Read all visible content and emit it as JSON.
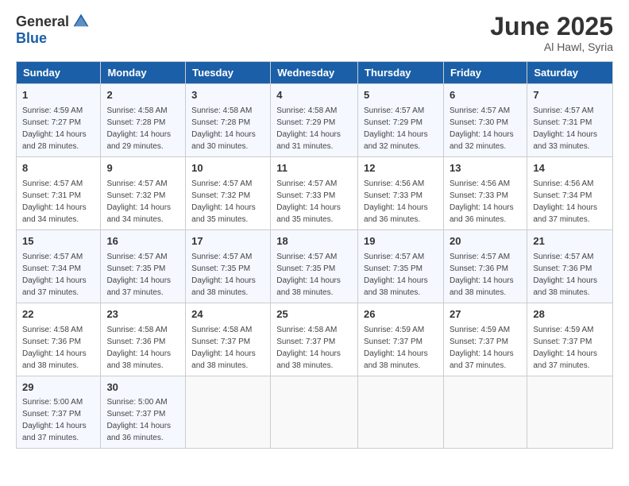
{
  "logo": {
    "general": "General",
    "blue": "Blue"
  },
  "title": "June 2025",
  "location": "Al Hawl, Syria",
  "header_days": [
    "Sunday",
    "Monday",
    "Tuesday",
    "Wednesday",
    "Thursday",
    "Friday",
    "Saturday"
  ],
  "weeks": [
    [
      {
        "day": "1",
        "sunrise": "Sunrise: 4:59 AM",
        "sunset": "Sunset: 7:27 PM",
        "daylight": "Daylight: 14 hours and 28 minutes."
      },
      {
        "day": "2",
        "sunrise": "Sunrise: 4:58 AM",
        "sunset": "Sunset: 7:28 PM",
        "daylight": "Daylight: 14 hours and 29 minutes."
      },
      {
        "day": "3",
        "sunrise": "Sunrise: 4:58 AM",
        "sunset": "Sunset: 7:28 PM",
        "daylight": "Daylight: 14 hours and 30 minutes."
      },
      {
        "day": "4",
        "sunrise": "Sunrise: 4:58 AM",
        "sunset": "Sunset: 7:29 PM",
        "daylight": "Daylight: 14 hours and 31 minutes."
      },
      {
        "day": "5",
        "sunrise": "Sunrise: 4:57 AM",
        "sunset": "Sunset: 7:29 PM",
        "daylight": "Daylight: 14 hours and 32 minutes."
      },
      {
        "day": "6",
        "sunrise": "Sunrise: 4:57 AM",
        "sunset": "Sunset: 7:30 PM",
        "daylight": "Daylight: 14 hours and 32 minutes."
      },
      {
        "day": "7",
        "sunrise": "Sunrise: 4:57 AM",
        "sunset": "Sunset: 7:31 PM",
        "daylight": "Daylight: 14 hours and 33 minutes."
      }
    ],
    [
      {
        "day": "8",
        "sunrise": "Sunrise: 4:57 AM",
        "sunset": "Sunset: 7:31 PM",
        "daylight": "Daylight: 14 hours and 34 minutes."
      },
      {
        "day": "9",
        "sunrise": "Sunrise: 4:57 AM",
        "sunset": "Sunset: 7:32 PM",
        "daylight": "Daylight: 14 hours and 34 minutes."
      },
      {
        "day": "10",
        "sunrise": "Sunrise: 4:57 AM",
        "sunset": "Sunset: 7:32 PM",
        "daylight": "Daylight: 14 hours and 35 minutes."
      },
      {
        "day": "11",
        "sunrise": "Sunrise: 4:57 AM",
        "sunset": "Sunset: 7:33 PM",
        "daylight": "Daylight: 14 hours and 35 minutes."
      },
      {
        "day": "12",
        "sunrise": "Sunrise: 4:56 AM",
        "sunset": "Sunset: 7:33 PM",
        "daylight": "Daylight: 14 hours and 36 minutes."
      },
      {
        "day": "13",
        "sunrise": "Sunrise: 4:56 AM",
        "sunset": "Sunset: 7:33 PM",
        "daylight": "Daylight: 14 hours and 36 minutes."
      },
      {
        "day": "14",
        "sunrise": "Sunrise: 4:56 AM",
        "sunset": "Sunset: 7:34 PM",
        "daylight": "Daylight: 14 hours and 37 minutes."
      }
    ],
    [
      {
        "day": "15",
        "sunrise": "Sunrise: 4:57 AM",
        "sunset": "Sunset: 7:34 PM",
        "daylight": "Daylight: 14 hours and 37 minutes."
      },
      {
        "day": "16",
        "sunrise": "Sunrise: 4:57 AM",
        "sunset": "Sunset: 7:35 PM",
        "daylight": "Daylight: 14 hours and 37 minutes."
      },
      {
        "day": "17",
        "sunrise": "Sunrise: 4:57 AM",
        "sunset": "Sunset: 7:35 PM",
        "daylight": "Daylight: 14 hours and 38 minutes."
      },
      {
        "day": "18",
        "sunrise": "Sunrise: 4:57 AM",
        "sunset": "Sunset: 7:35 PM",
        "daylight": "Daylight: 14 hours and 38 minutes."
      },
      {
        "day": "19",
        "sunrise": "Sunrise: 4:57 AM",
        "sunset": "Sunset: 7:35 PM",
        "daylight": "Daylight: 14 hours and 38 minutes."
      },
      {
        "day": "20",
        "sunrise": "Sunrise: 4:57 AM",
        "sunset": "Sunset: 7:36 PM",
        "daylight": "Daylight: 14 hours and 38 minutes."
      },
      {
        "day": "21",
        "sunrise": "Sunrise: 4:57 AM",
        "sunset": "Sunset: 7:36 PM",
        "daylight": "Daylight: 14 hours and 38 minutes."
      }
    ],
    [
      {
        "day": "22",
        "sunrise": "Sunrise: 4:58 AM",
        "sunset": "Sunset: 7:36 PM",
        "daylight": "Daylight: 14 hours and 38 minutes."
      },
      {
        "day": "23",
        "sunrise": "Sunrise: 4:58 AM",
        "sunset": "Sunset: 7:36 PM",
        "daylight": "Daylight: 14 hours and 38 minutes."
      },
      {
        "day": "24",
        "sunrise": "Sunrise: 4:58 AM",
        "sunset": "Sunset: 7:37 PM",
        "daylight": "Daylight: 14 hours and 38 minutes."
      },
      {
        "day": "25",
        "sunrise": "Sunrise: 4:58 AM",
        "sunset": "Sunset: 7:37 PM",
        "daylight": "Daylight: 14 hours and 38 minutes."
      },
      {
        "day": "26",
        "sunrise": "Sunrise: 4:59 AM",
        "sunset": "Sunset: 7:37 PM",
        "daylight": "Daylight: 14 hours and 38 minutes."
      },
      {
        "day": "27",
        "sunrise": "Sunrise: 4:59 AM",
        "sunset": "Sunset: 7:37 PM",
        "daylight": "Daylight: 14 hours and 37 minutes."
      },
      {
        "day": "28",
        "sunrise": "Sunrise: 4:59 AM",
        "sunset": "Sunset: 7:37 PM",
        "daylight": "Daylight: 14 hours and 37 minutes."
      }
    ],
    [
      {
        "day": "29",
        "sunrise": "Sunrise: 5:00 AM",
        "sunset": "Sunset: 7:37 PM",
        "daylight": "Daylight: 14 hours and 37 minutes."
      },
      {
        "day": "30",
        "sunrise": "Sunrise: 5:00 AM",
        "sunset": "Sunset: 7:37 PM",
        "daylight": "Daylight: 14 hours and 36 minutes."
      },
      null,
      null,
      null,
      null,
      null
    ]
  ]
}
